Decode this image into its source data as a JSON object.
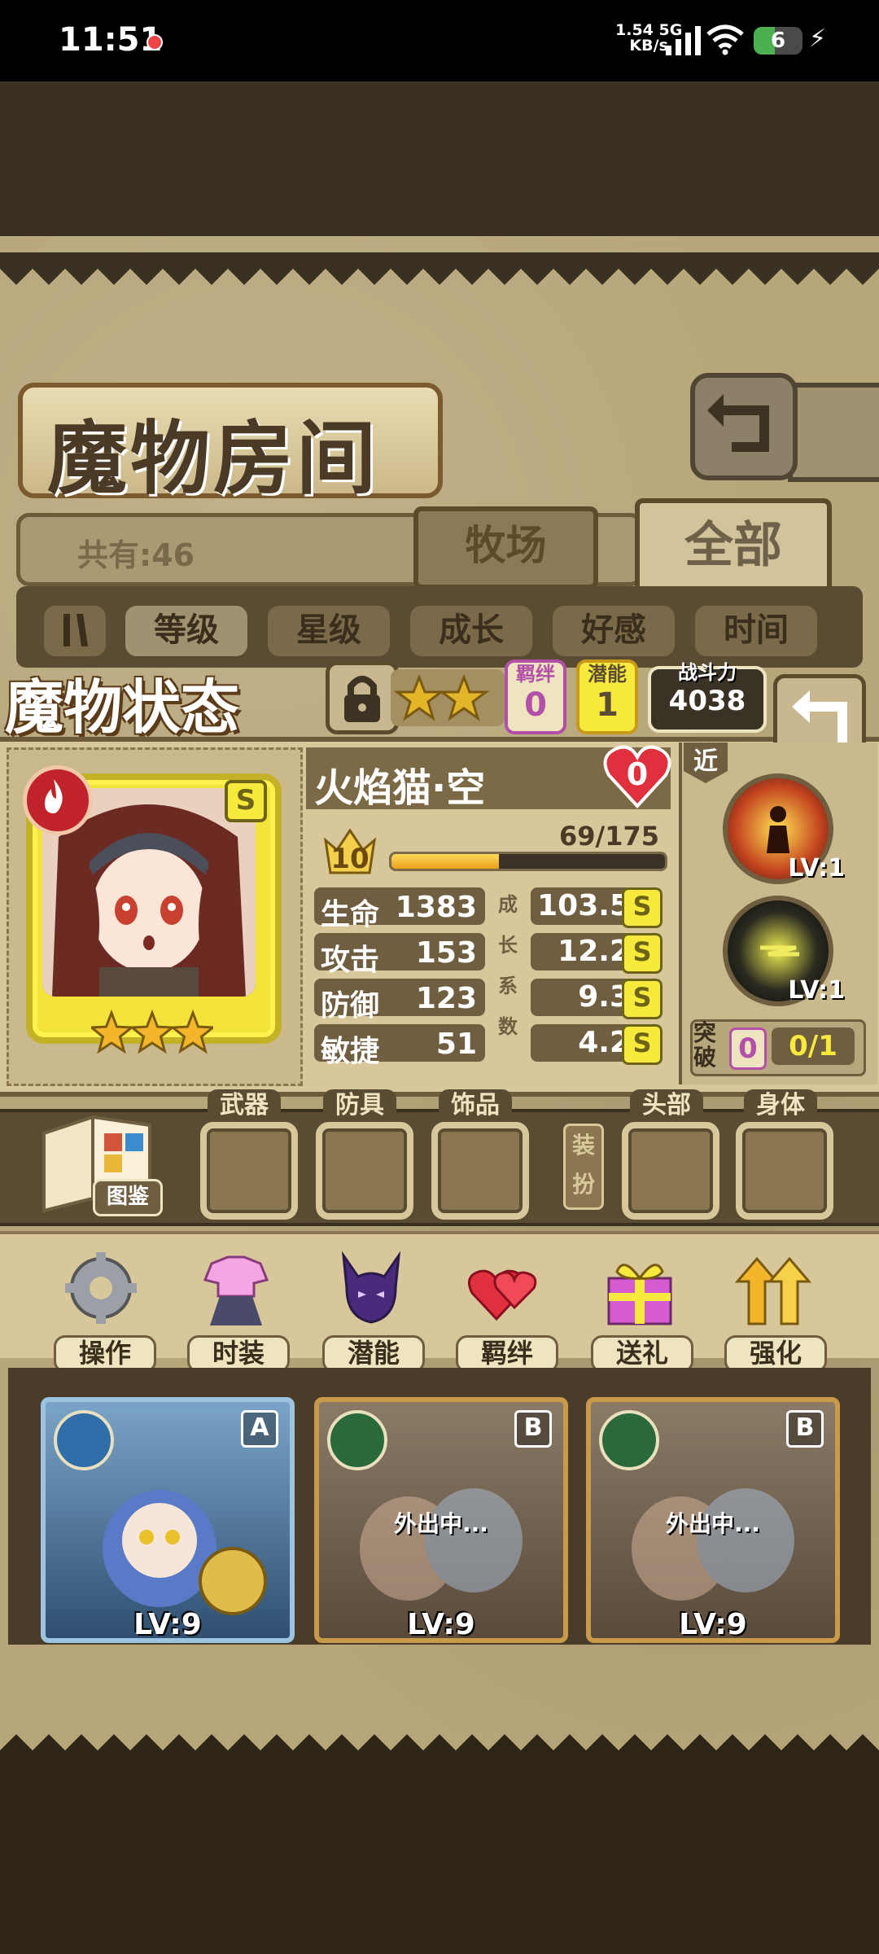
{
  "status_bar": {
    "time": "11:51",
    "net_speed": "1.54 5G",
    "net_unit": "KB/s",
    "wifi_badge": "6",
    "battery": "6"
  },
  "header": {
    "title": "魔物房间"
  },
  "filter": {
    "count": "共有:46",
    "tab_ranch": "牧场",
    "tab_all": "全部"
  },
  "sort": {
    "items": [
      "等级",
      "星级",
      "成长",
      "好感",
      "时间"
    ]
  },
  "status": {
    "title": "魔物状态",
    "bond_label": "羁绊",
    "bond_value": "0",
    "potential_label": "潜能",
    "potential_value": "1",
    "power_label": "战斗力",
    "power_value": "4038",
    "name": "火焰猫·空",
    "affection": "0",
    "grade": "S",
    "level": "10",
    "exp_text": "69/175",
    "exp_ratio": 0.394,
    "stars": 3,
    "growth_chars": [
      "成",
      "长",
      "系",
      "数"
    ],
    "stats": [
      {
        "name": "生命",
        "value": "1383",
        "growth": "103.5",
        "grade": "S"
      },
      {
        "name": "攻击",
        "value": "153",
        "growth": "12.2",
        "grade": "S"
      },
      {
        "name": "防御",
        "value": "123",
        "growth": "9.3",
        "grade": "S"
      },
      {
        "name": "敏捷",
        "value": "51",
        "growth": "4.2",
        "grade": "S"
      }
    ],
    "range_tag": "近",
    "skills": [
      {
        "level": "LV:1"
      },
      {
        "level": "LV:1"
      }
    ],
    "breakthrough_label": "突破",
    "breakthrough_value": "0",
    "breakthrough_progress": "0/1"
  },
  "equip": {
    "book_label": "图鉴",
    "slots": [
      "武器",
      "防具",
      "饰品",
      "头部",
      "身体"
    ],
    "dress_label": "装扮"
  },
  "actions": [
    "操作",
    "时装",
    "潜能",
    "羁绊",
    "送礼",
    "强化"
  ],
  "monsters": [
    {
      "rank": "A",
      "level": "LV:9",
      "status": ""
    },
    {
      "rank": "B",
      "level": "LV:9",
      "status": "外出中..."
    },
    {
      "rank": "B",
      "level": "LV:9",
      "status": "外出中..."
    }
  ],
  "colors": {
    "accent": "#f7ea3c",
    "panel": "#d8c79b",
    "dark": "#5a4c33",
    "bond": "#b24fa8",
    "potential": "#c89a1a"
  }
}
